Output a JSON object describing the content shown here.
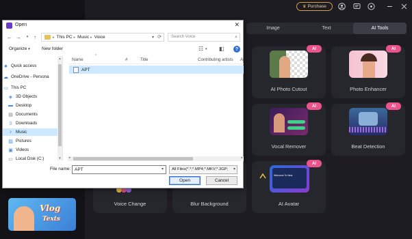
{
  "app": {
    "purchase_label": "Purchase",
    "tabs": [
      {
        "label": "Image",
        "active": false
      },
      {
        "label": "Text",
        "active": false
      },
      {
        "label": "AI Tools",
        "active": true
      }
    ],
    "badge_text": "AI",
    "cards": [
      {
        "label": "AI Photo Cutout"
      },
      {
        "label": "Photo Enhancer"
      },
      {
        "label": "Vocal Remover"
      },
      {
        "label": "Beat Detection"
      },
      {
        "label": "Voice Change"
      },
      {
        "label": "Blur Background"
      },
      {
        "label": "AI Avatar"
      }
    ],
    "avatar_thumb_text": "Welcome To Nest",
    "vlog_line1": "Vlog",
    "vlog_line2": "Texts",
    "accent_color": "#e9548f"
  },
  "dialog": {
    "title": "Open",
    "address": {
      "crumbs": [
        "This PC",
        "Music",
        "Voice"
      ]
    },
    "search_placeholder": "Search Voice",
    "toolbar": {
      "organize": "Organize",
      "new_folder": "New folder"
    },
    "nav_items": [
      {
        "label": "Quick access",
        "icon": "star-icon"
      },
      {
        "label": "OneDrive - Persona",
        "icon": "cloud-icon"
      },
      {
        "label": "This PC",
        "icon": "pc-icon"
      },
      {
        "label": "3D Objects",
        "icon": "cube-icon"
      },
      {
        "label": "Desktop",
        "icon": "desktop-icon"
      },
      {
        "label": "Documents",
        "icon": "document-icon"
      },
      {
        "label": "Downloads",
        "icon": "download-icon"
      },
      {
        "label": "Music",
        "icon": "music-icon",
        "selected": true
      },
      {
        "label": "Pictures",
        "icon": "picture-icon"
      },
      {
        "label": "Videos",
        "icon": "video-icon"
      },
      {
        "label": "Local Disk (C:)",
        "icon": "disk-icon"
      }
    ],
    "columns": {
      "name": "Name",
      "num": "#",
      "title": "Title",
      "artists": "Contributing artists",
      "album": "Al"
    },
    "files": [
      {
        "name": "APT",
        "selected": true
      }
    ],
    "file_name_label": "File name:",
    "file_name_value": "APT",
    "filter_value": "All Files(*.*;*.MP4;*.MKV;*.3GP;",
    "open_label": "Open",
    "cancel_label": "Cancel"
  }
}
